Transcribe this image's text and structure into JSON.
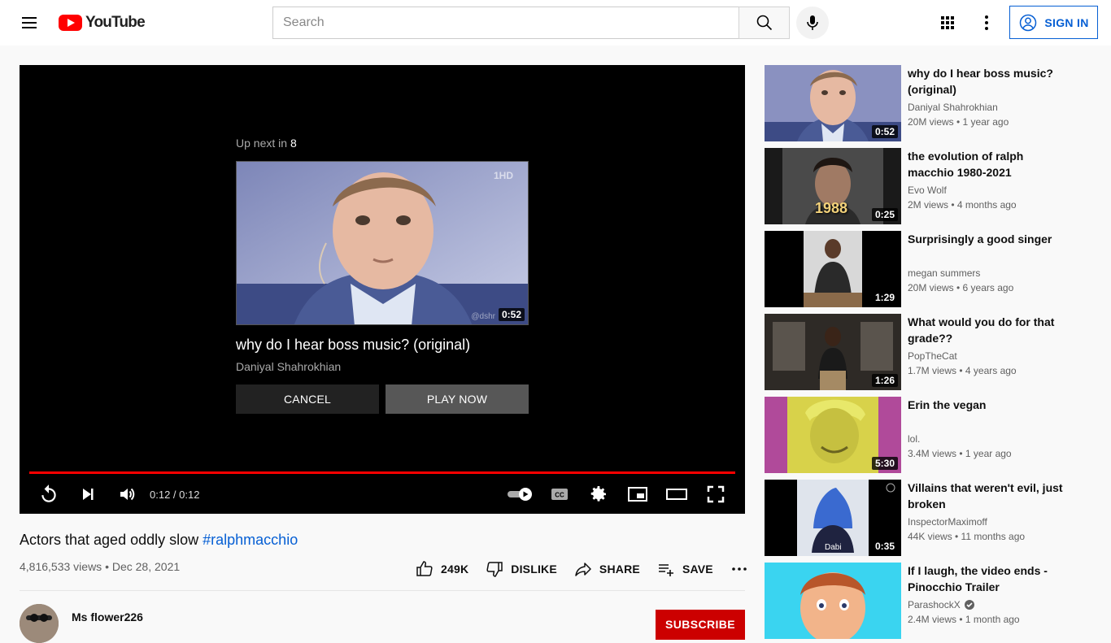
{
  "header": {
    "logo_text": "YouTube",
    "search_placeholder": "Search",
    "signin_label": "SIGN IN"
  },
  "player": {
    "upnext_label": "Up next in",
    "upnext_countdown": "8",
    "upnext_title": "why do I hear boss music? (original)",
    "upnext_channel": "Daniyal Shahrokhian",
    "upnext_duration": "0:52",
    "cancel_label": "CANCEL",
    "play_now_label": "PLAY NOW",
    "time_display": "0:12 / 0:12",
    "progress_fraction": 1.0,
    "watermark": "1HD",
    "thumb_credit": "@dshr"
  },
  "video": {
    "title": "Actors that aged oddly slow",
    "hashtag": "#ralphmacchio",
    "meta": "4,816,533 views • Dec 28, 2021",
    "likes": "249K",
    "dislike_label": "DISLIKE",
    "share_label": "SHARE",
    "save_label": "SAVE",
    "owner": "Ms flower226",
    "subscribe_label": "SUBSCRIBE"
  },
  "related": [
    {
      "title": "why do I hear boss music? (original)",
      "channel": "Daniyal Shahrokhian",
      "meta": "20M views • 1 year ago",
      "duration": "0:52",
      "verified": false
    },
    {
      "title": "the evolution of ralph macchio 1980-2021",
      "channel": "Evo Wolf",
      "meta": "2M views • 4 months ago",
      "duration": "0:25",
      "overlay": "1988",
      "verified": false
    },
    {
      "title": "Surprisingly a good singer",
      "channel": "megan summers",
      "meta": "20M views • 6 years ago",
      "duration": "1:29",
      "verified": false
    },
    {
      "title": "What would you do for that grade??",
      "channel": "PopTheCat",
      "meta": "1.7M views • 4 years ago",
      "duration": "1:26",
      "verified": false
    },
    {
      "title": "Erin the vegan",
      "channel": "lol.",
      "meta": "3.4M views • 1 year ago",
      "duration": "5:30",
      "verified": false
    },
    {
      "title": "Villains that weren't evil, just broken",
      "channel": "InspectorMaximoff",
      "meta": "44K views • 11 months ago",
      "duration": "0:35",
      "overlay": "Dabi",
      "verified": false
    },
    {
      "title": "If I laugh, the video ends - Pinocchio Trailer",
      "channel": "ParashockX",
      "meta": "2.4M views • 1 month ago",
      "duration": "",
      "verified": true
    }
  ],
  "colors": {
    "brand_red": "#ff0000",
    "link_blue": "#065fd4",
    "subscribe_red": "#cc0000"
  }
}
